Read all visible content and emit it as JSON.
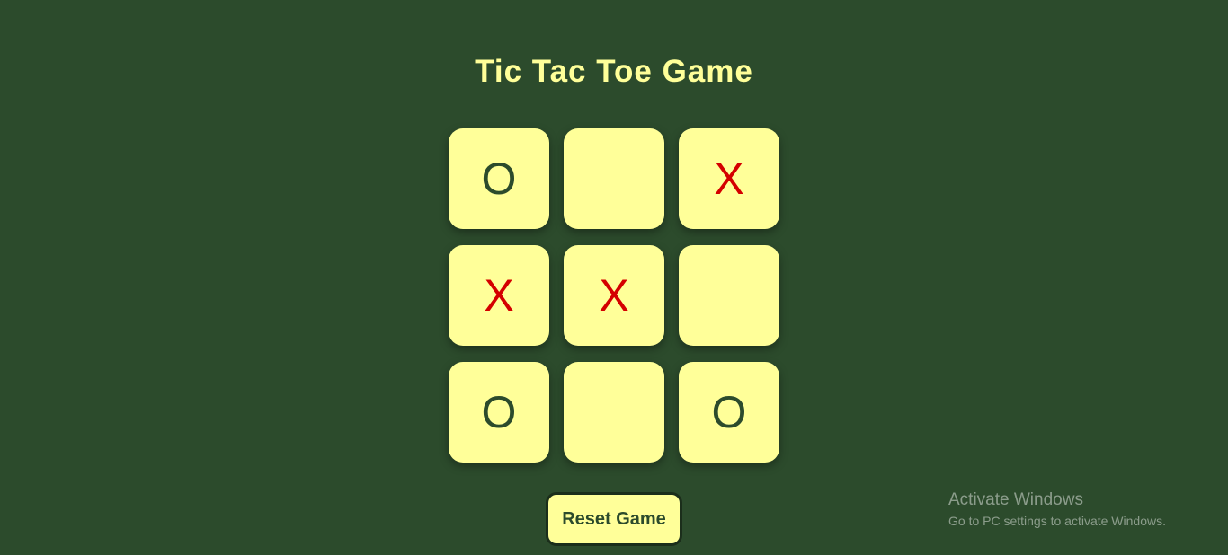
{
  "title": "Tic Tac Toe Game",
  "board": {
    "cells": [
      "O",
      "",
      "X",
      "X",
      "X",
      "",
      "O",
      "",
      "O"
    ]
  },
  "reset_label": "Reset Game",
  "watermark": {
    "title": "Activate Windows",
    "subtitle": "Go to PC settings to activate Windows."
  },
  "colors": {
    "background": "#2c4b2c",
    "accent": "#ffff99",
    "x_mark": "#d40000",
    "o_mark": "#2c4b2c"
  }
}
